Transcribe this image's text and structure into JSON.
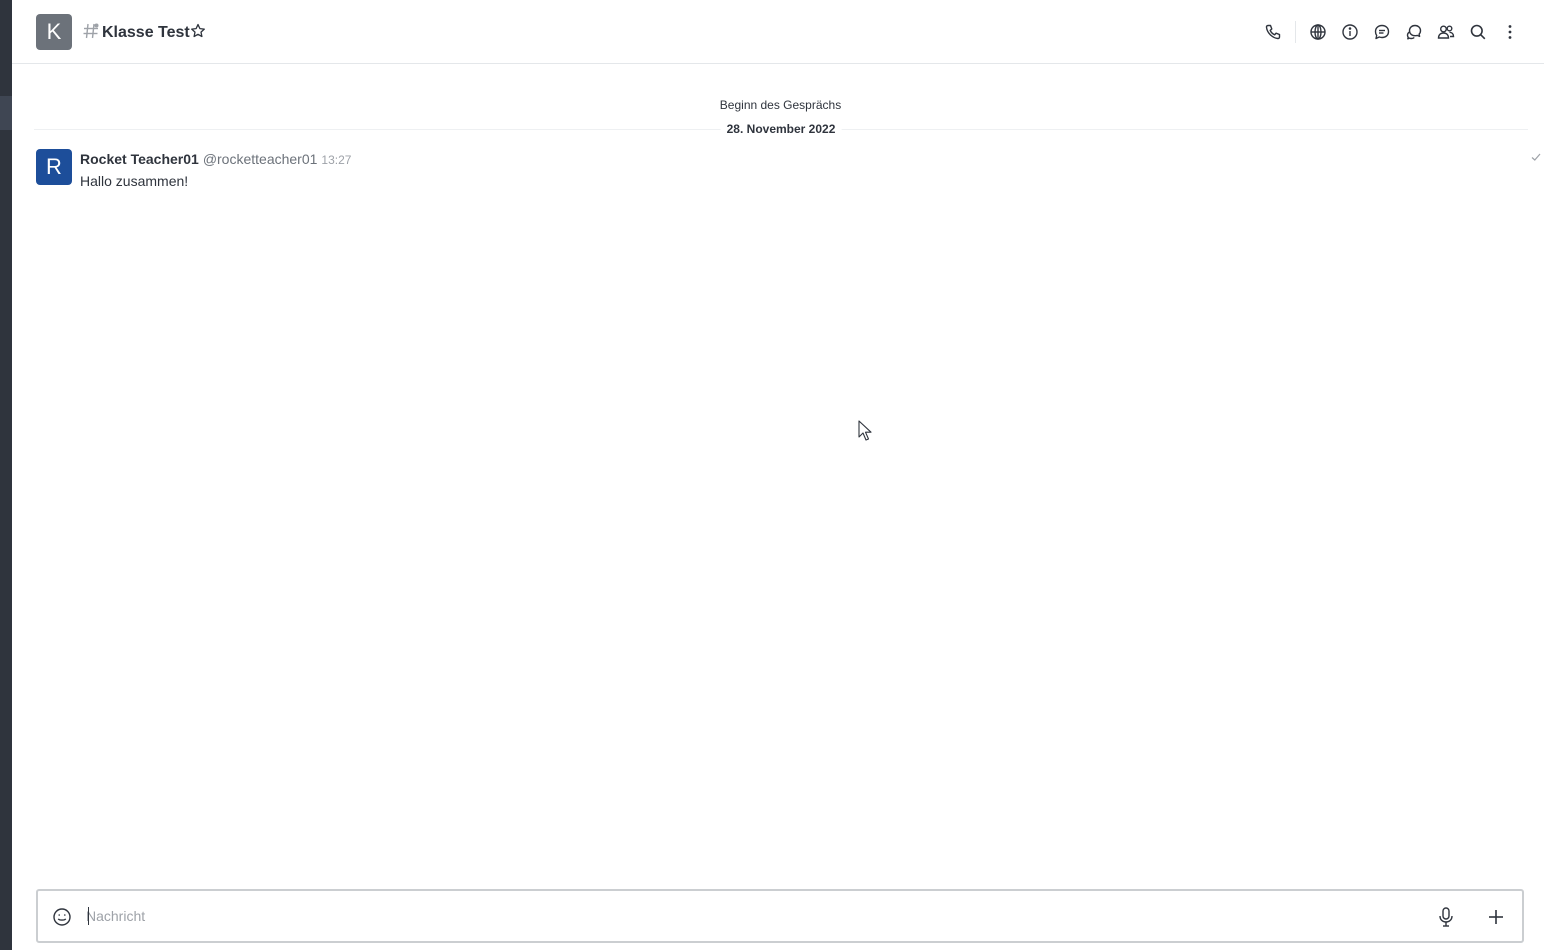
{
  "room": {
    "avatar_letter": "K",
    "title": "Klasse Test"
  },
  "header": {
    "icons": [
      "channel-icon",
      "star-icon",
      "phone-icon",
      "globe-icon",
      "info-icon",
      "threads-icon",
      "discussion-icon",
      "members-icon",
      "search-icon",
      "kebab-icon"
    ]
  },
  "conversation": {
    "start_label": "Beginn des Gesprächs",
    "date_divider": "28. November 2022"
  },
  "messages": [
    {
      "avatar_letter": "R",
      "name": "Rocket Teacher01",
      "username": "@rocketteacher01",
      "time": "13:27",
      "text": "Hallo zusammen!"
    }
  ],
  "composer": {
    "placeholder": "Nachricht"
  },
  "colors": {
    "room_avatar": "#6c727a",
    "user_avatar": "#1d4e9a",
    "sidebar": "#2f343d",
    "text": "#2f343d",
    "muted": "#9ea2a8"
  }
}
